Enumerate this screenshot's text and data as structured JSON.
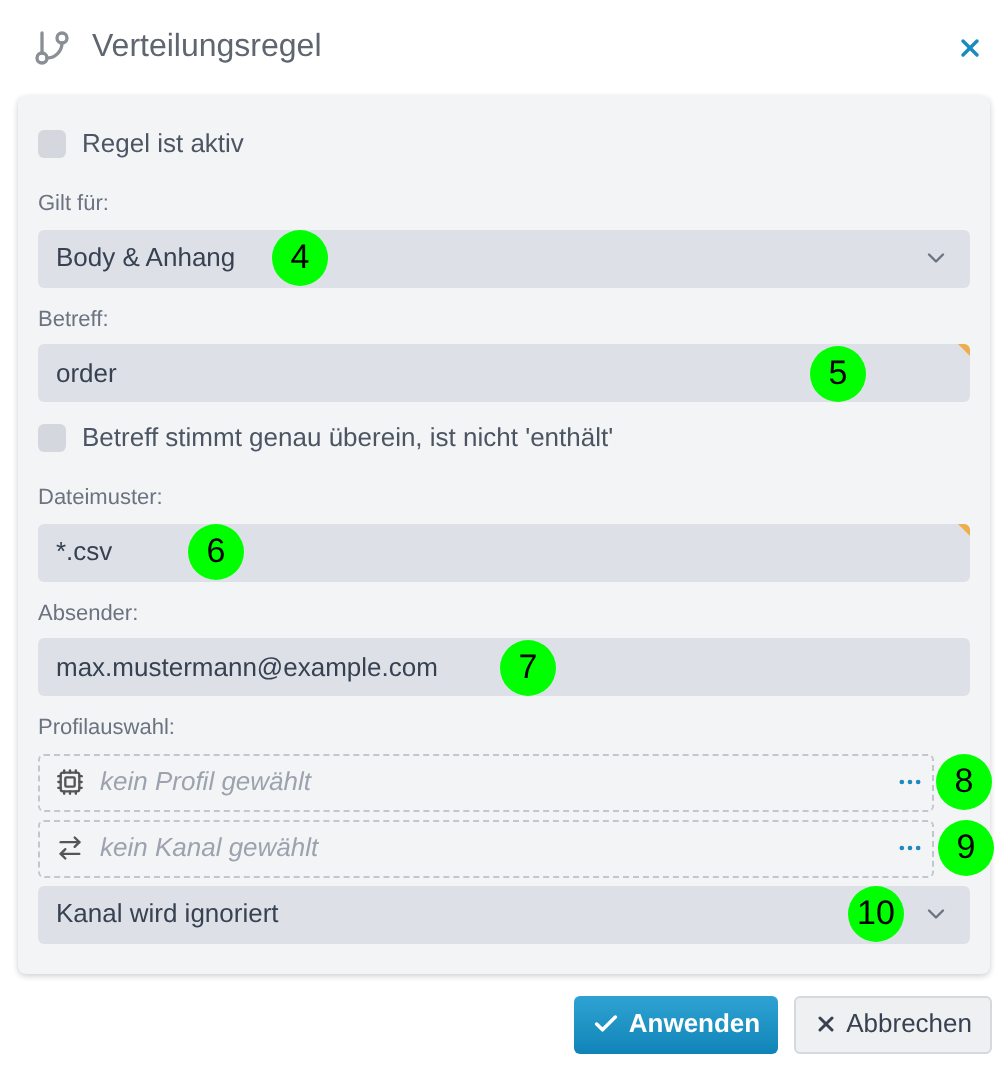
{
  "window": {
    "title": "Verteilungsregel"
  },
  "fields": [
    {
      "kind": "checkbox",
      "label": "Regel ist aktiv",
      "checked": false
    },
    {
      "kind": "select",
      "label": "Gilt für:",
      "value": "Body & Anhang",
      "marker": "4"
    },
    {
      "kind": "input",
      "label": "Betreff:",
      "value": "order",
      "marker": "5",
      "flagged": true
    },
    {
      "kind": "checkbox",
      "label": "Betreff stimmt genau überein, ist nicht 'enthält'",
      "checked": false
    },
    {
      "kind": "input",
      "label": "Dateimuster:",
      "value": "*.csv",
      "marker": "6",
      "flagged": true
    },
    {
      "kind": "input",
      "label": "Absender:",
      "value": "max.mustermann@example.com",
      "marker": "7",
      "flagged": false
    },
    {
      "kind": "profile-picker",
      "label": "Profilauswahl:",
      "placeholder": "kein Profil gewählt",
      "marker": "8"
    },
    {
      "kind": "channel-picker",
      "placeholder": "kein Kanal gewählt",
      "marker": "9"
    },
    {
      "kind": "select",
      "value": "Kanal wird ignoriert",
      "marker": "10"
    }
  ],
  "buttons": [
    {
      "label": "Anwenden",
      "kind": "primary"
    },
    {
      "label": "Abbrechen",
      "kind": "secondary"
    }
  ]
}
